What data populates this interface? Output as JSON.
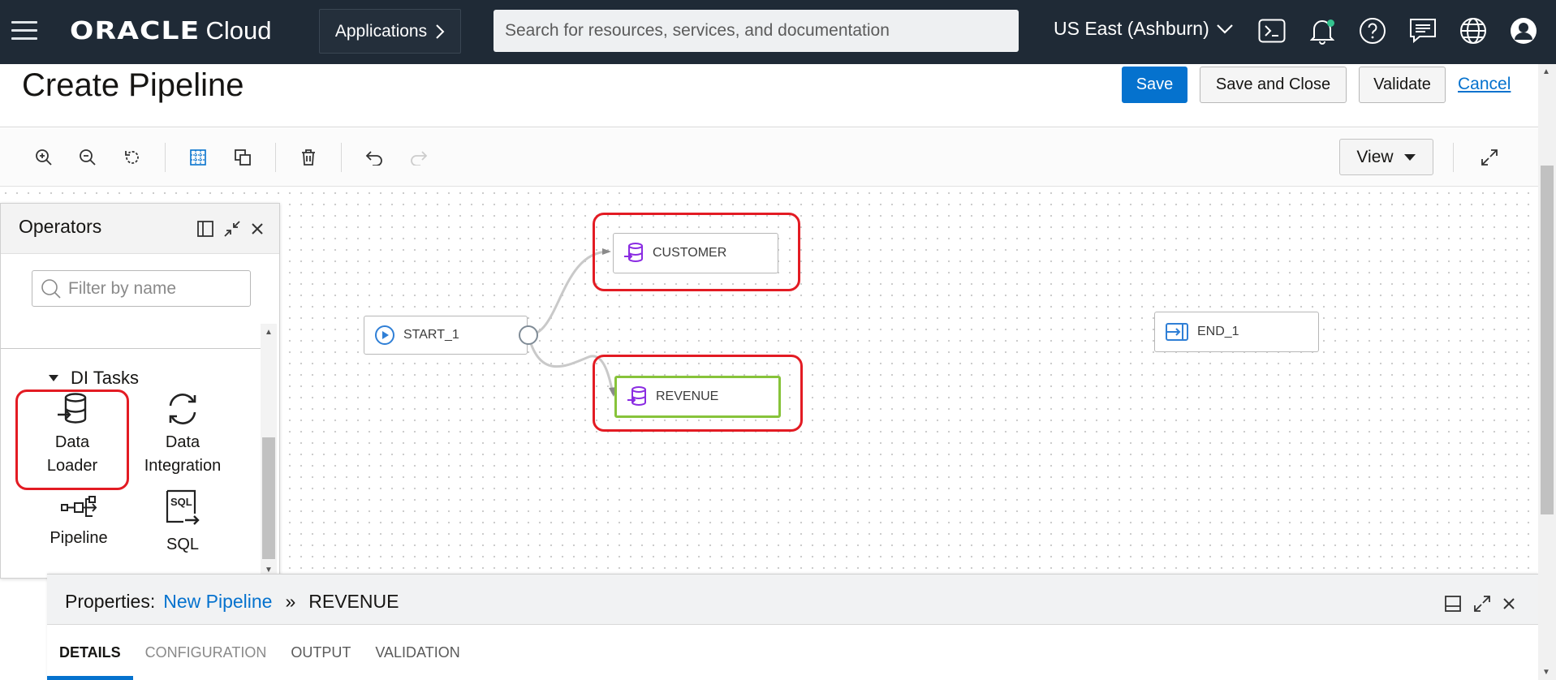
{
  "topbar": {
    "brand": "ORACLE",
    "product": "Cloud",
    "applications_label": "Applications",
    "search_placeholder": "Search for resources, services, and documentation",
    "region": "US East (Ashburn)",
    "icons": [
      "cloud-shell-icon",
      "bell-icon",
      "help-icon",
      "chat-icon",
      "globe-icon",
      "user-icon"
    ]
  },
  "header": {
    "title": "Create Pipeline",
    "save": "Save",
    "save_close": "Save and Close",
    "validate": "Validate",
    "cancel": "Cancel"
  },
  "toolbar": {
    "view_label": "View",
    "icons": [
      "zoom-in-icon",
      "zoom-out-icon",
      "reset-icon",
      "grid-icon",
      "copy-icon",
      "delete-icon",
      "undo-icon",
      "redo-icon",
      "fullscreen-icon"
    ]
  },
  "operators": {
    "title": "Operators",
    "filter_placeholder": "Filter by name",
    "group": "DI Tasks",
    "items": [
      {
        "line1": "Data",
        "line2": "Loader",
        "icon": "data-loader-icon"
      },
      {
        "line1": "Data",
        "line2": "Integration",
        "icon": "data-integration-icon"
      },
      {
        "line1": "Pipeline",
        "line2": "",
        "icon": "pipeline-icon"
      },
      {
        "line1": "SQL",
        "line2": "",
        "icon": "sql-icon"
      }
    ]
  },
  "canvas": {
    "nodes": {
      "start": "START_1",
      "customer": "CUSTOMER",
      "revenue": "REVENUE",
      "end": "END_1"
    }
  },
  "properties": {
    "label": "Properties:",
    "pipeline_link": "New Pipeline",
    "separator": "»",
    "selected": "REVENUE",
    "tabs": [
      "DETAILS",
      "CONFIGURATION",
      "OUTPUT",
      "VALIDATION"
    ],
    "active_tab": "DETAILS"
  },
  "colors": {
    "topbar": "#1f2a36",
    "primary": "#0572ce",
    "highlight": "#e31b23",
    "selected_node": "#87c33a",
    "task_icon": "#8a2be2"
  }
}
